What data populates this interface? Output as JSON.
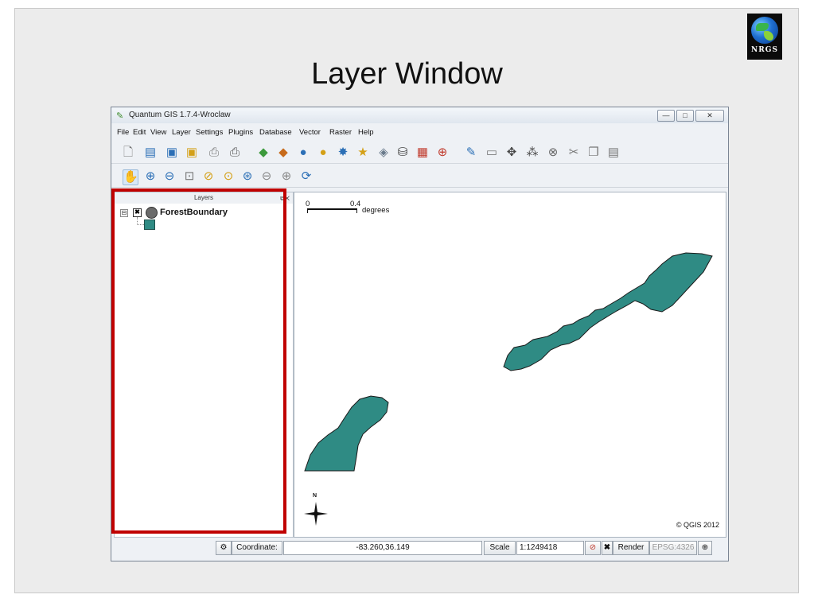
{
  "slide": {
    "title": "Layer Window",
    "logo_text": "NRGS"
  },
  "window": {
    "title": "Quantum GIS 1.7.4-Wroclaw",
    "controls": {
      "minimize": "—",
      "maximize": "□",
      "close": "✕"
    }
  },
  "menubar": [
    "File",
    "Edit",
    "View",
    "Layer",
    "Settings",
    "Plugins",
    "Database",
    "Vector",
    "Raster",
    "Help"
  ],
  "toolbar1_icons": [
    "new-project-icon",
    "open-project-icon",
    "save-project-icon",
    "save-as-icon",
    "print-composer-icon",
    "print-icon",
    "add-vector-layer-icon",
    "add-raster-layer-icon",
    "add-postgis-layer-icon",
    "add-spatialite-layer-icon",
    "add-wms-layer-icon",
    "new-shapefile-icon",
    "add-wfs-layer-icon",
    "database-icon",
    "open-table-icon",
    "toggle-editing-icon",
    "save-edits-icon",
    "move-feature-icon",
    "node-tool-icon",
    "delete-selected-icon",
    "cut-features-icon",
    "copy-features-icon",
    "paste-features-icon"
  ],
  "toolbar2_icons": [
    "pan-icon",
    "zoom-in-icon",
    "zoom-out-icon",
    "zoom-full-icon",
    "zoom-to-selection-icon",
    "zoom-to-layer-icon",
    "zoom-actual-size-icon",
    "zoom-last-icon",
    "zoom-next-icon",
    "refresh-icon"
  ],
  "layers_panel": {
    "title": "Layers",
    "toggle": "⊟",
    "checked_mark": "✖",
    "layers": [
      {
        "name": "ForestBoundary",
        "fill_color": "#2f8b84"
      }
    ]
  },
  "map": {
    "scale_start": "0",
    "scale_end": "0.4",
    "scale_unit": "degrees",
    "north_label": "N",
    "copyright": "© QGIS 2012",
    "polygon_color": "#2f8b84"
  },
  "statusbar": {
    "coordinate_label": "Coordinate:",
    "coordinate_value": "-83.260,36.149",
    "scale_label": "Scale",
    "scale_value": "1:1249418",
    "render_label": "Render",
    "render_checked_mark": "✖",
    "crs": "EPSG:4326"
  }
}
